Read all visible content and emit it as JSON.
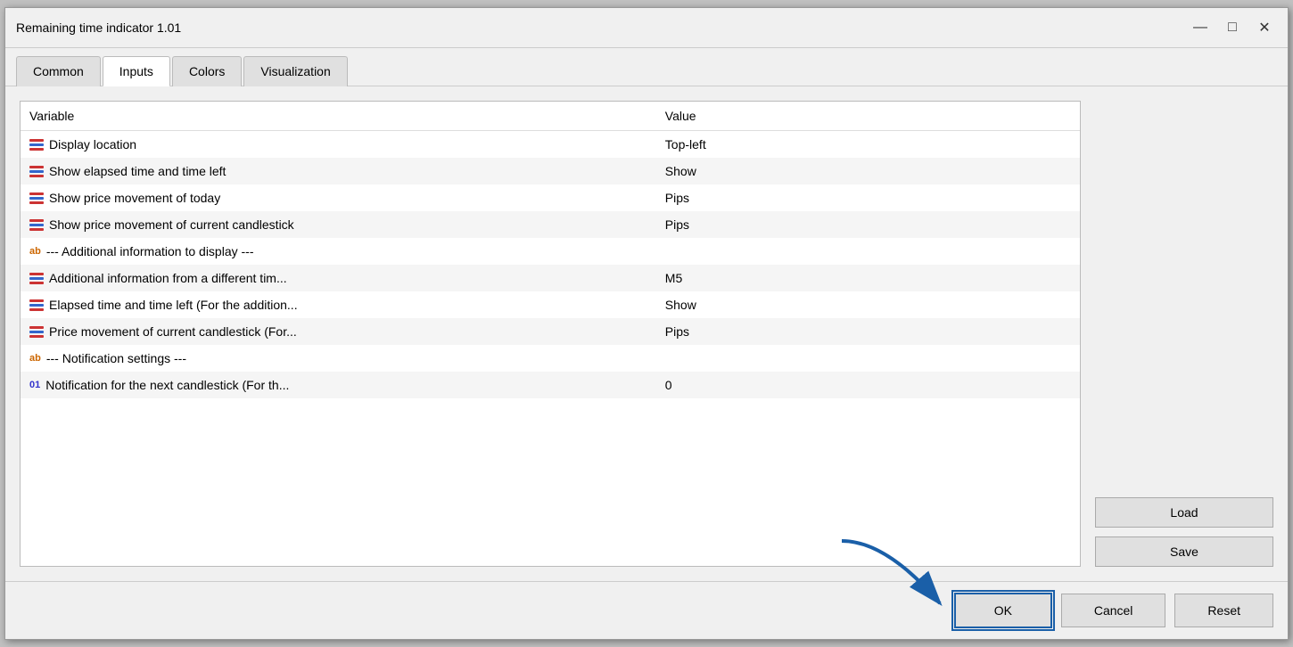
{
  "window": {
    "title": "Remaining time indicator 1.01",
    "minimize_label": "—",
    "maximize_label": "□",
    "close_label": "✕"
  },
  "tabs": [
    {
      "id": "common",
      "label": "Common",
      "active": false
    },
    {
      "id": "inputs",
      "label": "Inputs",
      "active": true
    },
    {
      "id": "colors",
      "label": "Colors",
      "active": false
    },
    {
      "id": "visualization",
      "label": "Visualization",
      "active": false
    }
  ],
  "table": {
    "headers": [
      "Variable",
      "Value"
    ],
    "rows": [
      {
        "icon": "lines",
        "variable": "Display location",
        "value": "Top-left"
      },
      {
        "icon": "lines",
        "variable": "Show elapsed time and time left",
        "value": "Show"
      },
      {
        "icon": "lines",
        "variable": "Show price movement of today",
        "value": "Pips"
      },
      {
        "icon": "lines",
        "variable": "Show price movement of current candlestick",
        "value": "Pips"
      },
      {
        "icon": "ab",
        "variable": "--- Additional information to display ---",
        "value": ""
      },
      {
        "icon": "lines",
        "variable": "Additional information from a different tim...",
        "value": "M5"
      },
      {
        "icon": "lines",
        "variable": "Elapsed time and time left (For the addition...",
        "value": "Show"
      },
      {
        "icon": "lines",
        "variable": "Price movement of current candlestick (For...",
        "value": "Pips"
      },
      {
        "icon": "ab",
        "variable": "--- Notification settings ---",
        "value": ""
      },
      {
        "icon": "01",
        "variable": "Notification for the next candlestick (For th...",
        "value": "0"
      }
    ]
  },
  "side_buttons": {
    "load_label": "Load",
    "save_label": "Save"
  },
  "bottom_buttons": {
    "ok_label": "OK",
    "cancel_label": "Cancel",
    "reset_label": "Reset"
  }
}
